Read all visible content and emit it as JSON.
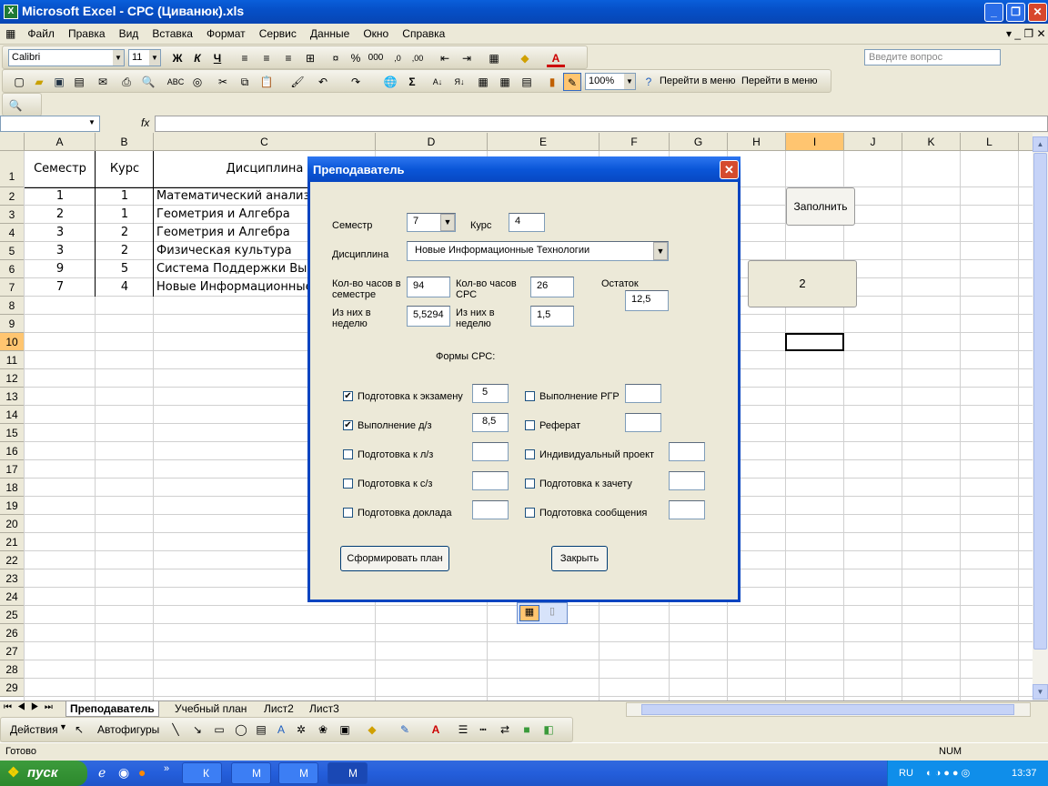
{
  "window": {
    "title": "Microsoft Excel - СРС (Циванюк).xls",
    "help_placeholder": "Введите вопрос"
  },
  "menu": [
    "Файл",
    "Правка",
    "Вид",
    "Вставка",
    "Формат",
    "Сервис",
    "Данные",
    "Окно",
    "Справка"
  ],
  "format_toolbar": {
    "font": "Calibri",
    "size": "11",
    "bold": "Ж",
    "italic": "К",
    "underline": "Ч",
    "percent": "%",
    "thousands": "000"
  },
  "standard_toolbar": {
    "zoom": "100%",
    "goto1": "Перейти в меню",
    "goto2": "Перейти в меню"
  },
  "formula_bar": {
    "fx": "fx",
    "name": "",
    "formula": ""
  },
  "columns": [
    "A",
    "B",
    "C",
    "D",
    "E",
    "F",
    "G",
    "H",
    "I",
    "J",
    "K",
    "L"
  ],
  "rows": [
    "1",
    "2",
    "3",
    "4",
    "5",
    "6",
    "7",
    "8",
    "9",
    "10",
    "11",
    "12",
    "13",
    "14",
    "15",
    "16",
    "17",
    "18",
    "19",
    "20",
    "21",
    "22",
    "23",
    "24",
    "25",
    "26",
    "27",
    "28",
    "29"
  ],
  "sheet": {
    "header": {
      "a": "Семестр",
      "b": "Курс",
      "c": "Дисциплина"
    },
    "data": [
      {
        "a": "1",
        "b": "1",
        "c": "Математический анализ"
      },
      {
        "a": "2",
        "b": "1",
        "c": "Геометрия и Алгебра"
      },
      {
        "a": "3",
        "b": "2",
        "c": "Геометрия и Алгебра"
      },
      {
        "a": "3",
        "b": "2",
        "c": "Физическая культура"
      },
      {
        "a": "9",
        "b": "5",
        "c": "Система Поддержки Выработ"
      },
      {
        "a": "7",
        "b": "4",
        "c": "Новые Информационные Те"
      }
    ],
    "fill_button": "Заполнить",
    "button_2": "2"
  },
  "tabs": [
    "Преподаватель",
    "Учебный план",
    "Лист2",
    "Лист3"
  ],
  "dialog": {
    "title": "Преподаватель",
    "semester_label": "Семестр",
    "semester_value": "7",
    "course_label": "Курс",
    "course_value": "4",
    "discipline_label": "Дисциплина",
    "discipline_value": "Новые Информационные Технологии",
    "hours_sem_label": "Кол-во часов в семестре",
    "hours_sem_value": "94",
    "hours_srs_label": "Кол-во часов СРС",
    "hours_srs_value": "26",
    "remainder_label": "Остаток",
    "remainder_value": "12,5",
    "week1_label": "Из них в неделю",
    "week1_value": "5,5294",
    "week2_label": "Из них в неделю",
    "week2_value": "1,5",
    "forms_label": "Формы СРС:",
    "left_checks": [
      {
        "label": "Подготовка к экзамену",
        "checked": true,
        "value": "5"
      },
      {
        "label": "Выполнение д/з",
        "checked": true,
        "value": "8,5"
      },
      {
        "label": "Подготовка к л/з",
        "checked": false,
        "value": ""
      },
      {
        "label": "Подготовка к с/з",
        "checked": false,
        "value": ""
      },
      {
        "label": "Подготовка доклада",
        "checked": false,
        "value": ""
      }
    ],
    "right_checks": [
      {
        "label": "Выполнение РГР",
        "checked": false,
        "value": ""
      },
      {
        "label": "Реферат",
        "checked": false,
        "value": ""
      },
      {
        "label": "Индивидуальный проект",
        "checked": false,
        "value": ""
      },
      {
        "label": "Подготовка к зачету",
        "checked": false,
        "value": ""
      },
      {
        "label": "Подготовка сообщения",
        "checked": false,
        "value": ""
      }
    ],
    "form_plan": "Сформировать план",
    "close": "Закрыть"
  },
  "drawing": {
    "actions": "Действия",
    "autoshapes": "Автофигуры"
  },
  "status": {
    "ready": "Готово",
    "num": "NUM"
  },
  "taskbar": {
    "start": "пуск",
    "tasks": [
      "К",
      "М",
      "М",
      "М"
    ],
    "lang": "RU",
    "time": "13:37"
  }
}
